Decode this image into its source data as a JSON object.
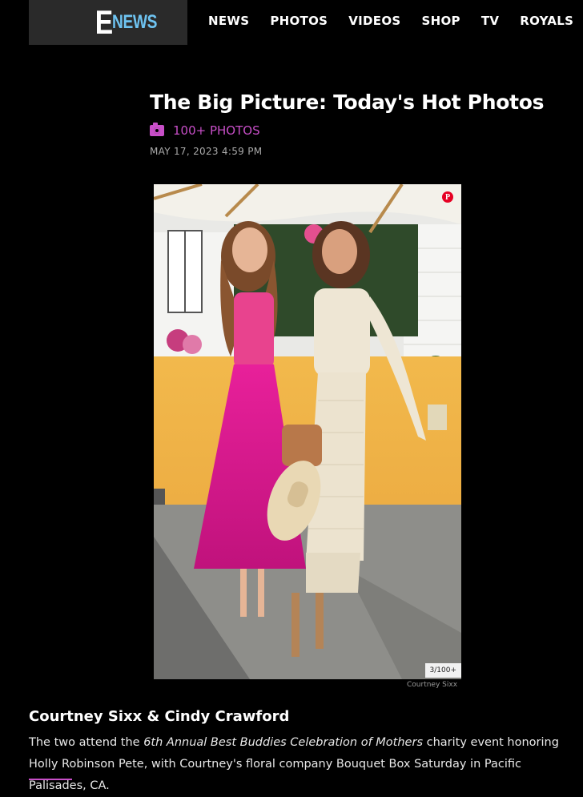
{
  "header": {
    "logo": {
      "e": "E",
      "news": "NEWS"
    },
    "nav": [
      "NEWS",
      "PHOTOS",
      "VIDEOS",
      "SHOP",
      "TV",
      "ROYALS"
    ]
  },
  "gallery": {
    "title": "The Big Picture: Today's Hot Photos",
    "photo_count": "100+ PHOTOS",
    "date": "MAY 17, 2023 4:59 PM"
  },
  "photo": {
    "counter": "3/100+",
    "credit": "Courtney Sixx",
    "pin_icon": "pinterest-icon"
  },
  "caption": {
    "title": "Courtney Sixx & Cindy Crawford",
    "text_before": "The two attend the ",
    "text_italic": "6th Annual Best Buddies Celebration of Mothers",
    "text_after": " charity event honoring Holly Robinson Pete, with Courtney's floral company Bouquet Box Saturday in Pacific Palisades, CA."
  },
  "colors": {
    "accent": "#c84fc8",
    "logo_blue": "#6ec3f1",
    "background": "#000000"
  }
}
